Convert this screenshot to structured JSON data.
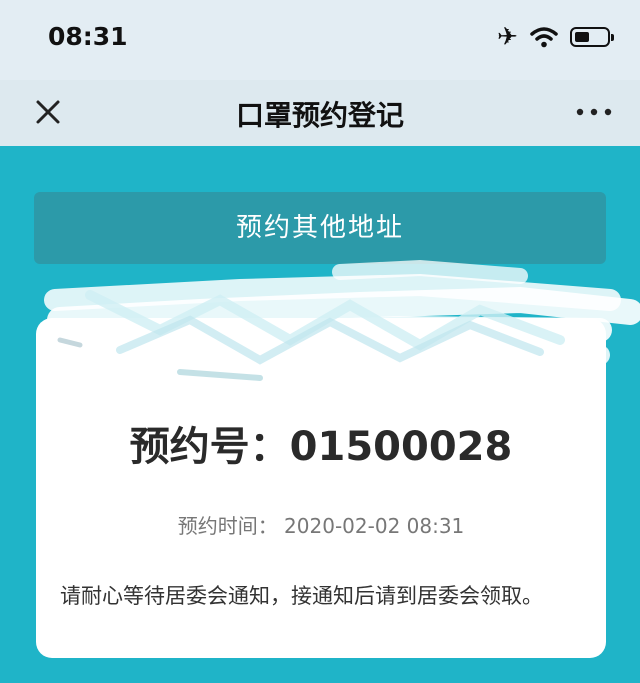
{
  "status_bar": {
    "time": "08:31"
  },
  "nav": {
    "title": "口罩预约登记"
  },
  "actions": {
    "other_address_label": "预约其他地址"
  },
  "appointment": {
    "number_label": "预约号：01500028",
    "time_label": "预约时间： 2020-02-02 08:31",
    "notice": "请耐心等待居委会通知，接通知后请到居委会领取。"
  },
  "colors": {
    "background": "#1fb4c8",
    "button": "#2c9aa9",
    "card": "#ffffff"
  }
}
